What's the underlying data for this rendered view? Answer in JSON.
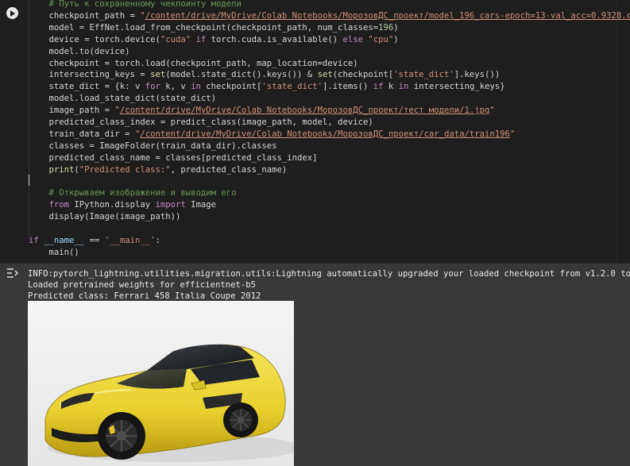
{
  "cell": {
    "run_button_icon": "play-circle-icon",
    "code_lines": [
      {
        "indent": "    ",
        "segments": [
          {
            "t": "# Путь к сохраненному чекпоинту модели",
            "c": "c-comment"
          }
        ]
      },
      {
        "indent": "    ",
        "segments": [
          {
            "t": "checkpoint_path = ",
            "c": ""
          },
          {
            "t": "\"",
            "c": "c-string"
          },
          {
            "t": "/content/drive/MyDrive/Colab Notebooks/МорозовДС_проект/model_196_cars-epoch=13-val_acc=0.9328.ckpt",
            "c": "c-link"
          },
          {
            "t": "\"",
            "c": "c-string"
          }
        ]
      },
      {
        "indent": "    ",
        "segments": [
          {
            "t": "model = EffNet.load_from_checkpoint(checkpoint_path, num_classes=",
            "c": ""
          },
          {
            "t": "196",
            "c": "c-num"
          },
          {
            "t": ")",
            "c": ""
          }
        ]
      },
      {
        "indent": "    ",
        "segments": [
          {
            "t": "device = torch.device(",
            "c": ""
          },
          {
            "t": "\"cuda\"",
            "c": "c-string"
          },
          {
            "t": " if ",
            "c": "c-kw"
          },
          {
            "t": "torch.cuda.is_available() ",
            "c": ""
          },
          {
            "t": "else",
            "c": "c-kw"
          },
          {
            "t": " ",
            "c": ""
          },
          {
            "t": "\"cpu\"",
            "c": "c-string"
          },
          {
            "t": ")",
            "c": ""
          }
        ]
      },
      {
        "indent": "    ",
        "segments": [
          {
            "t": "model.to(device)",
            "c": ""
          }
        ]
      },
      {
        "indent": "    ",
        "segments": [
          {
            "t": "checkpoint = torch.load(checkpoint_path, map_location=device)",
            "c": ""
          }
        ]
      },
      {
        "indent": "    ",
        "segments": [
          {
            "t": "intersecting_keys = ",
            "c": ""
          },
          {
            "t": "set",
            "c": "c-fn"
          },
          {
            "t": "(model.state_dict().keys()) & ",
            "c": ""
          },
          {
            "t": "set",
            "c": "c-fn"
          },
          {
            "t": "(checkpoint[",
            "c": ""
          },
          {
            "t": "'state_dict'",
            "c": "c-string"
          },
          {
            "t": "].keys())",
            "c": ""
          }
        ]
      },
      {
        "indent": "    ",
        "segments": [
          {
            "t": "state_dict = {k: v ",
            "c": ""
          },
          {
            "t": "for",
            "c": "c-kw"
          },
          {
            "t": " k, v ",
            "c": ""
          },
          {
            "t": "in",
            "c": "c-kw"
          },
          {
            "t": " checkpoint[",
            "c": ""
          },
          {
            "t": "'state_dict'",
            "c": "c-string"
          },
          {
            "t": "].items() ",
            "c": ""
          },
          {
            "t": "if",
            "c": "c-kw"
          },
          {
            "t": " k ",
            "c": ""
          },
          {
            "t": "in",
            "c": "c-kw"
          },
          {
            "t": " intersecting_keys}",
            "c": ""
          }
        ]
      },
      {
        "indent": "    ",
        "segments": [
          {
            "t": "model.load_state_dict(state_dict)",
            "c": ""
          }
        ]
      },
      {
        "indent": "    ",
        "segments": [
          {
            "t": "image_path = ",
            "c": ""
          },
          {
            "t": "\"",
            "c": "c-string"
          },
          {
            "t": "/content/drive/MyDrive/Colab Notebooks/МорозовДС_проект/тест модели/1.jpg",
            "c": "c-link"
          },
          {
            "t": "\"",
            "c": "c-string"
          }
        ]
      },
      {
        "indent": "    ",
        "segments": [
          {
            "t": "predicted_class_index = predict_class(image_path, model, device)",
            "c": ""
          }
        ]
      },
      {
        "indent": "    ",
        "segments": [
          {
            "t": "train_data_dir = ",
            "c": ""
          },
          {
            "t": "\"",
            "c": "c-string"
          },
          {
            "t": "/content/drive/MyDrive/Colab Notebooks/МорозовДС_проект/car_data/train196",
            "c": "c-link"
          },
          {
            "t": "\"",
            "c": "c-string"
          }
        ]
      },
      {
        "indent": "    ",
        "segments": [
          {
            "t": "classes = ImageFolder(train_data_dir).classes",
            "c": ""
          }
        ]
      },
      {
        "indent": "    ",
        "segments": [
          {
            "t": "predicted_class_name = classes[predicted_class_index]",
            "c": ""
          }
        ]
      },
      {
        "indent": "    ",
        "segments": [
          {
            "t": "print",
            "c": "c-fn"
          },
          {
            "t": "(",
            "c": ""
          },
          {
            "t": "\"Predicted class:\"",
            "c": "c-string"
          },
          {
            "t": ", predicted_class_name)",
            "c": ""
          }
        ]
      },
      {
        "indent": "",
        "segments": [
          {
            "t": "",
            "c": ""
          }
        ]
      },
      {
        "indent": "    ",
        "segments": [
          {
            "t": "# Открываем изображение и выводим его",
            "c": "c-comment"
          }
        ]
      },
      {
        "indent": "    ",
        "segments": [
          {
            "t": "from",
            "c": "c-kw"
          },
          {
            "t": " IPython.display ",
            "c": ""
          },
          {
            "t": "import",
            "c": "c-kw"
          },
          {
            "t": " Image",
            "c": ""
          }
        ]
      },
      {
        "indent": "    ",
        "segments": [
          {
            "t": "display(Image(image_path))",
            "c": ""
          }
        ]
      },
      {
        "indent": "",
        "segments": [
          {
            "t": "",
            "c": ""
          }
        ]
      },
      {
        "indent": "",
        "segments": [
          {
            "t": "if",
            "c": "c-kw"
          },
          {
            "t": " ",
            "c": ""
          },
          {
            "t": "__name__",
            "c": "c-dunder"
          },
          {
            "t": " == ",
            "c": ""
          },
          {
            "t": "'__main__'",
            "c": "c-string"
          },
          {
            "t": ":",
            "c": ""
          }
        ]
      },
      {
        "indent": "    ",
        "segments": [
          {
            "t": "main()",
            "c": ""
          }
        ]
      }
    ]
  },
  "output": {
    "icon": "output-toggle-icon",
    "lines": [
      "INFO:pytorch_lightning.utilities.migration.utils:Lightning automatically upgraded your loaded checkpoint from v1.2.0 to v2.2.4",
      "Loaded pretrained weights for efficientnet-b5",
      "Predicted class: Ferrari 458 Italia Coupe 2012"
    ],
    "image_description_icon": "yellow-sports-car-photo"
  }
}
